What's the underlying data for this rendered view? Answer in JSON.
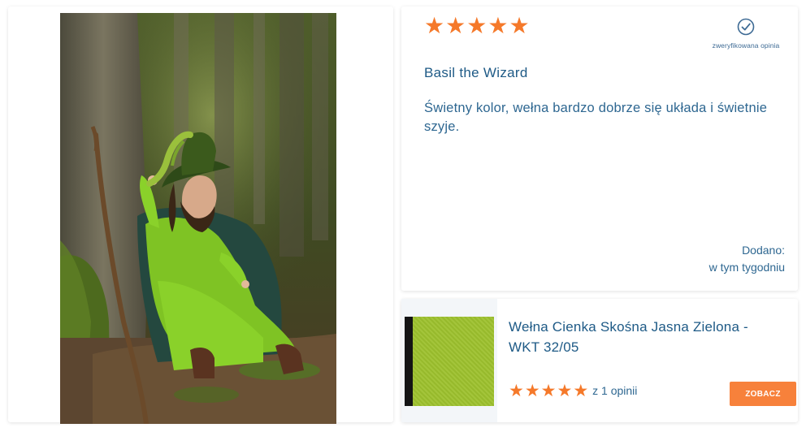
{
  "review": {
    "rating": 5,
    "stars": [
      "★",
      "★",
      "★",
      "★",
      "★"
    ],
    "verified_label": "zweryfikowana opinia",
    "author": "Basil the Wizard",
    "text": "Świetny kolor, wełna bardzo dobrze się układa i świetnie szyje.",
    "added_label": "Dodano:",
    "added_value": "w tym tygodniu"
  },
  "product": {
    "name": "Wełna Cienka Skośna Jasna Zielona - WKT 32/05",
    "rating": 5,
    "stars": [
      "★",
      "★",
      "★",
      "★",
      "★"
    ],
    "opinions": "z 1 opinii",
    "button_label": "ZOBACZ",
    "swatch_color": "#9dc12e"
  },
  "colors": {
    "accent_orange": "#f5792a",
    "text_blue": "#2e6791",
    "title_blue": "#1e5a86"
  }
}
